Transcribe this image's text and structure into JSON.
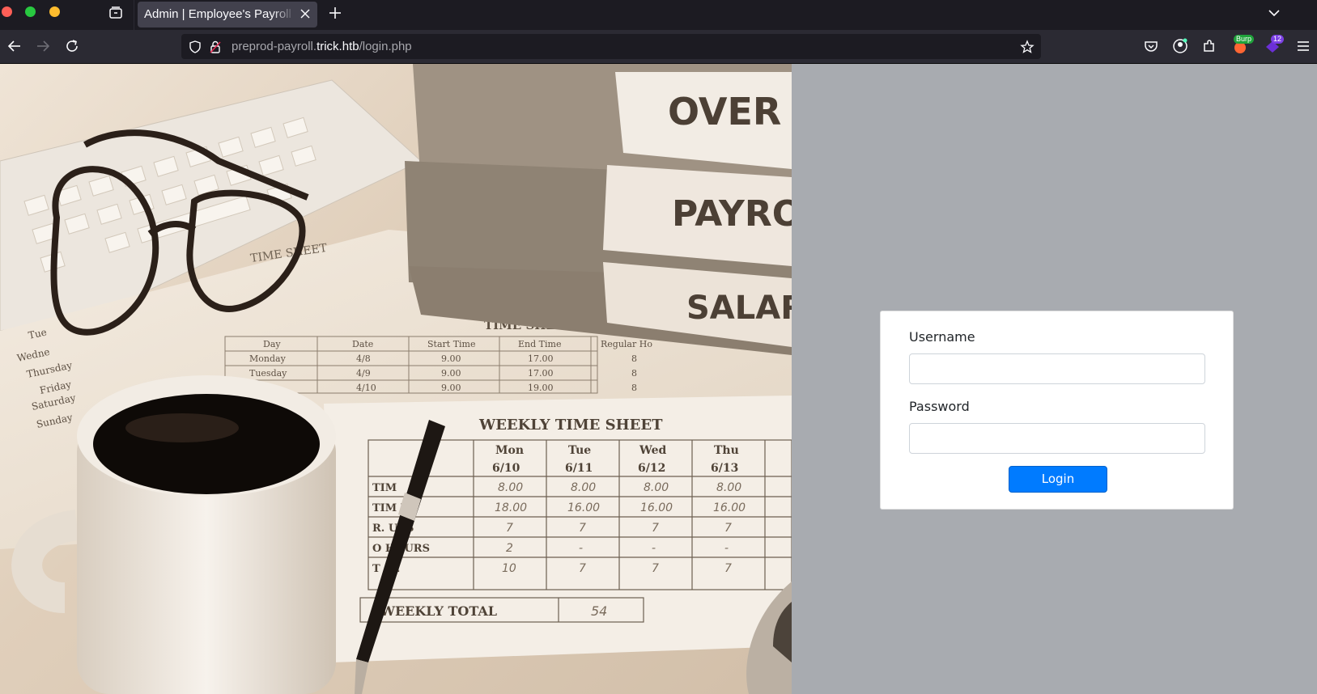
{
  "browser": {
    "tab_title": "Admin | Employee's Payroll Management System",
    "url_prefix": "preprod-payroll.",
    "url_host": "trick.htb",
    "url_path": "/login.php",
    "extension_badges": {
      "burp": "Burp",
      "count": "12"
    }
  },
  "hero_image": {
    "ledger_spines": [
      "OVER T",
      "PAYRO",
      "SALARY"
    ],
    "timesheet_small_title": "TIME SHEET",
    "timesheet_small_mid_title": "TIME SHEET",
    "small_headers": [
      "Day",
      "Date",
      "Start Time",
      "End Time",
      "Regular Ho"
    ],
    "small_rows": [
      [
        "Monday",
        "4/8",
        "9.00",
        "17.00",
        "8"
      ],
      [
        "Tuesday",
        "4/9",
        "9.00",
        "17.00",
        "8"
      ],
      [
        "",
        "4/10",
        "9.00",
        "19.00",
        "8"
      ]
    ],
    "left_days": [
      "Tue",
      "Wedne",
      "Thursday",
      "Friday",
      "Saturday",
      "Sunday"
    ],
    "weekly_title": "WEEKLY TIME SHEET",
    "weekly_days": [
      "Mon",
      "Tue",
      "Wed",
      "Thu"
    ],
    "weekly_dates": [
      "6/10",
      "6/11",
      "6/12",
      "6/13"
    ],
    "row_labels": [
      "TIM",
      "TIM   UT",
      "R.   URS",
      "O    HOURS",
      "T    AL"
    ],
    "rows": [
      [
        "8.00",
        "8.00",
        "8.00",
        "8.00"
      ],
      [
        "18.00",
        "16.00",
        "16.00",
        "16.00"
      ],
      [
        "7",
        "7",
        "7",
        "7"
      ],
      [
        "2",
        "-",
        "-",
        "-"
      ],
      [
        "10",
        "7",
        "7",
        "7"
      ]
    ],
    "weekly_total_label": "WEEKLY TOTAL",
    "weekly_total_value": "54"
  },
  "login": {
    "username_label": "Username",
    "username_value": "",
    "password_label": "Password",
    "password_value": "",
    "button_label": "Login"
  },
  "colors": {
    "page_bg": "#a8abb0",
    "primary_button": "#007bff",
    "chrome_dark": "#1c1b22"
  }
}
